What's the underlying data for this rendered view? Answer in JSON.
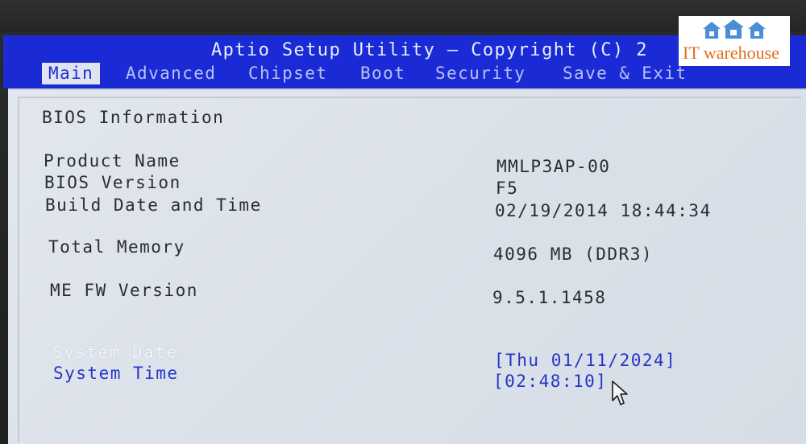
{
  "header": {
    "title": "Aptio Setup Utility – Copyright (C) 2"
  },
  "tabs": [
    {
      "label": "Main",
      "active": true
    },
    {
      "label": "Advanced",
      "active": false
    },
    {
      "label": "Chipset",
      "active": false
    },
    {
      "label": "Boot",
      "active": false
    },
    {
      "label": "Security",
      "active": false
    },
    {
      "label": "Save & Exit",
      "active": false
    }
  ],
  "main": {
    "section_title": "BIOS Information",
    "rows": [
      {
        "label": "Product Name",
        "value": "MMLP3AP-00"
      },
      {
        "label": "BIOS Version",
        "value": "F5"
      },
      {
        "label": "Build Date and Time",
        "value": "02/19/2014 18:44:34"
      },
      {
        "label": "Total Memory",
        "value": "4096 MB (DDR3)"
      },
      {
        "label": "ME FW Version",
        "value": "9.5.1.1458"
      }
    ],
    "system_date": {
      "label": "System Date",
      "value": "[Thu 01/11/2024]"
    },
    "system_time": {
      "label": "System Time",
      "value": "[02:48:10]"
    }
  },
  "watermark": {
    "text": "IT warehouse",
    "colors": {
      "text": "#e86b1f",
      "houses": "#4a8fd6"
    }
  },
  "colors": {
    "title_bar": "#1a2bd6",
    "content_bg": "#dfe4ee",
    "selectable_text": "#2336c9",
    "label_text": "#2a2c33"
  }
}
